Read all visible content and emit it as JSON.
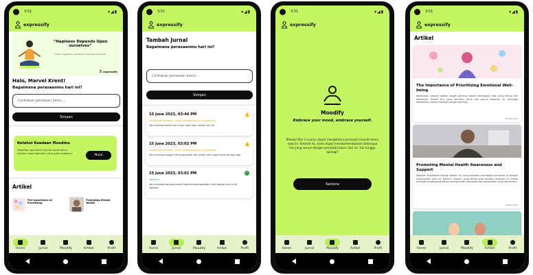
{
  "status": {
    "time": "3:51",
    "icons": "▾◢▮"
  },
  "brand": "expressify",
  "nav": [
    {
      "key": "home",
      "label": "Home"
    },
    {
      "key": "jurnal",
      "label": "Jurnal"
    },
    {
      "key": "moodify",
      "label": "Moodify"
    },
    {
      "key": "artikel",
      "label": "Artikel"
    },
    {
      "key": "profil",
      "label": "Profil"
    }
  ],
  "home": {
    "banner_quote": "“Hapiness Depends Upon ourselves”",
    "banner_sub": "Cerita, ungkapkan perasaanmu kepada expressify",
    "banner_brand": "expressify",
    "greeting": "Halo, Marvel Krent!",
    "question": "Bagaimana perasaanmu hari ini?",
    "input_placeholder": "Ceritakan perasaan kamu...",
    "save_label": "Simpan",
    "mood_card_title": "Ketahui Keadaan Moodmu",
    "mood_card_desc": "Dapatkan gambaran kondisi mood kamu melalui mood detection yang kami sediakan",
    "mood_card_button": "Mulai",
    "articles_title": "Artikel",
    "mini_articles": [
      {
        "title": "The Importance of Prioritizing"
      },
      {
        "title": "Promoting Mental Health"
      }
    ]
  },
  "journal": {
    "title": "Tambah Jurnal",
    "question": "Bagaimana perasaanmu hari ini?",
    "input_placeholder": "Ceritakan perasaan kamu...",
    "save_label": "Simpan",
    "entries": [
      {
        "date": "15 June 2023, 03:46 PM",
        "status": "Direkomendasikan untuk berkonsultasi ke psikolog",
        "text": "Aku merasa sedih dan ingin mati saja untuk hari ini"
      },
      {
        "date": "15 June 2023, 03:02 PM",
        "status": "Direkomendasikan untuk berkonsultasi ke psikolog",
        "text": "Aku merasa tangan terus gemetar dan tidak tahu ingin berbuat apa lagi"
      },
      {
        "date": "15 June 2023, 03:01 PM",
        "status": "Terkirim",
        "text": "Aku merasa senang sekali karena mendapatkan nilai bagus hari ini di sekolah"
      }
    ]
  },
  "moodify": {
    "name": "Moodify",
    "tagline": "Embrace your mood, embrace yourself.",
    "description": "Melalui fitur ini kamu dapat mengetahui perasaan (mood) kamu saat ini. Setelah itu, kami dapat merekomendasikan beberapa hal yang sesuai dengan perasaan kamu hari ini. Yuk tunggu apalagi?",
    "camera_label": "Kamera"
  },
  "artikel": {
    "title": "Artikel",
    "items": [
      {
        "title": "The Importance of Prioritizing Emotional Well-being",
        "body": "Kesehatan mental adalah aspek penting dalam kehidupan kita yang sering kali diabaikan. Dalam era yang semakin sibuk dan penuh tekanan ini, menjaga kesehatan mental menjadi sangat penting.",
        "date": "15 Mei 2023"
      },
      {
        "title": "Promoting Mental Health Awareness and Support",
        "body": "Masalah kesehatan mental adalah isu yang semakin mendapat perhatian di tengah masyarakat saat ini. Namun, stigma yang masih ada seputar masalah ini masih menjadi penghalang dalam memperoleh dukungan dan perawatan yang diperlukan.",
        "date": "14 Mei 2023"
      }
    ]
  },
  "colors": {
    "accent": "#c4f562",
    "dark": "#0d0d0d",
    "nav_bg": "#e6f2c9",
    "warning": "#e0a400",
    "success": "#2b9a3e"
  }
}
